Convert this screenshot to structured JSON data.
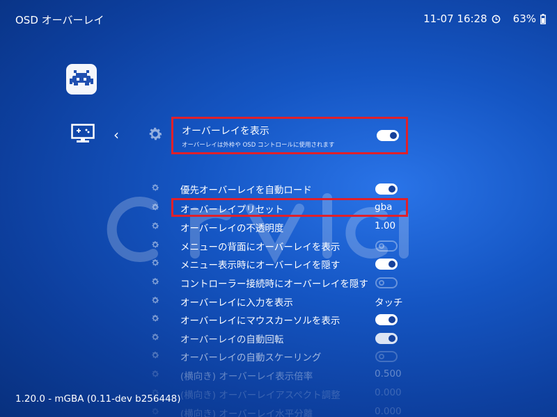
{
  "header": {
    "title": "OSD オーバーレイ",
    "datetime": "11-07 16:28",
    "battery": "63%"
  },
  "primary_item": {
    "label": "オーバーレイを表示",
    "sublabel": "オーバーレイは外枠や OSD コントロールに使用されます",
    "toggle": "on"
  },
  "items": [
    {
      "label": "優先オーバーレイを自動ロード",
      "type": "toggle",
      "state": "on"
    },
    {
      "label": "オーバーレイプリセット",
      "type": "value",
      "value": "gba"
    },
    {
      "label": "オーバーレイの不透明度",
      "type": "value",
      "value": "1.00"
    },
    {
      "label": "メニューの背面にオーバーレイを表示",
      "type": "toggle",
      "state": "off"
    },
    {
      "label": "メニュー表示時にオーバーレイを隠す",
      "type": "toggle",
      "state": "on"
    },
    {
      "label": "コントローラー接続時にオーバーレイを隠す",
      "type": "toggle",
      "state": "off"
    },
    {
      "label": "オーバーレイに入力を表示",
      "type": "value",
      "value": "タッチ"
    },
    {
      "label": "オーバーレイにマウスカーソルを表示",
      "type": "toggle",
      "state": "on"
    },
    {
      "label": "オーバーレイの自動回転",
      "type": "toggle",
      "state": "on"
    },
    {
      "label": "オーバーレイの自動スケーリング",
      "type": "toggle",
      "state": "off"
    },
    {
      "label": "(横向き) オーバーレイ表示倍率",
      "type": "value",
      "value": "0.500"
    },
    {
      "label": "(横向き) オーバーレイアスペクト調整",
      "type": "value",
      "value": "0.000"
    },
    {
      "label": "(横向き) オーバーレイ水平分離",
      "type": "value",
      "value": "0.000"
    }
  ],
  "footer": {
    "version": "1.20.0 - mGBA (0.11-dev b256448)"
  },
  "colors": {
    "highlight_border": "#e0202a",
    "background": "#1556c4"
  }
}
